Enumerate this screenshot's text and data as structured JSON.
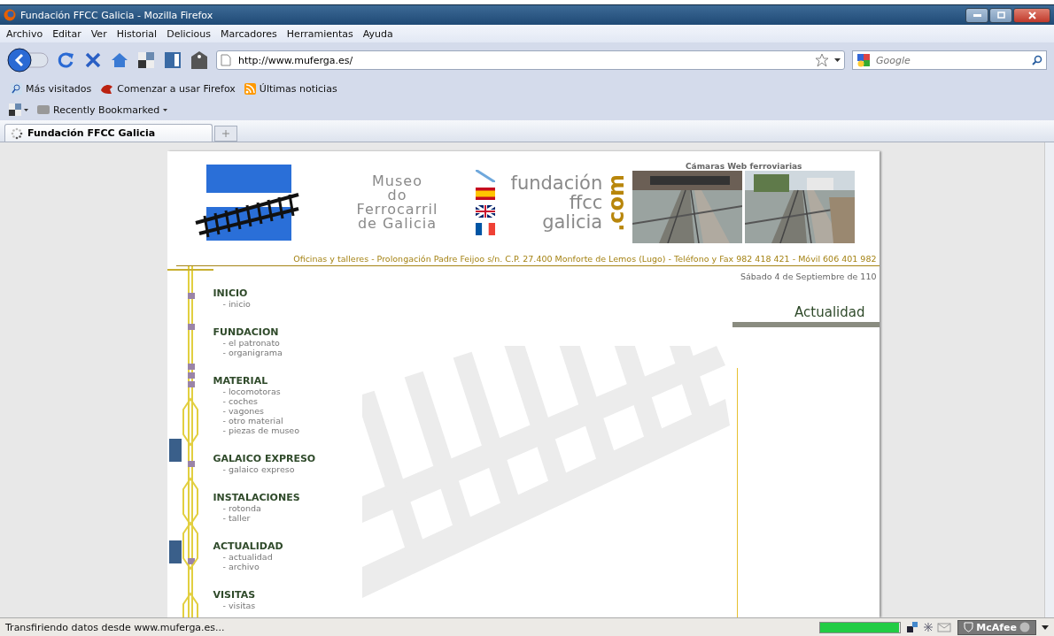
{
  "window": {
    "title": "Fundación FFCC Galicia - Mozilla Firefox"
  },
  "menu": [
    "Archivo",
    "Editar",
    "Ver",
    "Historial",
    "Delicious",
    "Marcadores",
    "Herramientas",
    "Ayuda"
  ],
  "address": {
    "value": "http://www.muferga.es/"
  },
  "search": {
    "placeholder": "Google"
  },
  "bookmarks": [
    {
      "label": "Más visitados",
      "kind": "search"
    },
    {
      "label": "Comenzar a usar Firefox",
      "kind": "firefox"
    },
    {
      "label": "Últimas noticias",
      "kind": "feed"
    }
  ],
  "bookmarks2": [
    {
      "label": "Recently Bookmarked"
    }
  ],
  "tabs": [
    {
      "label": "Fundación FFCC Galicia",
      "selected": true
    }
  ],
  "page": {
    "museum_name": [
      "Museo",
      "do",
      "Ferrocarril",
      "de Galicia"
    ],
    "brand": [
      "fundación",
      "ffcc",
      "galicia"
    ],
    "brand_suffix": ".com",
    "webcams_title": "Cámaras Web ferroviarias",
    "flags": [
      {
        "kind": "none"
      },
      {
        "kind": "es"
      },
      {
        "kind": "uk"
      },
      {
        "kind": "fr"
      }
    ],
    "address_line": "Oficinas y talleres - Prolongación Padre Feijoo s/n. C.P. 27.400 Monforte de Lemos (Lugo) - Teléfono y Fax 982 418 421 - Móvil 606 401 982",
    "date": "Sábado 4 de Septiembre de 110",
    "nav": [
      {
        "title": "INICIO",
        "items": [
          "- inicio"
        ]
      },
      {
        "title": "FUNDACION",
        "items": [
          "- el patronato",
          "- organigrama"
        ]
      },
      {
        "title": "MATERIAL",
        "items": [
          "- locomotoras",
          "- coches",
          "- vagones",
          "- otro material",
          "- piezas de museo"
        ]
      },
      {
        "title": "GALAICO EXPRESO",
        "items": [
          "- galaico expreso"
        ]
      },
      {
        "title": "INSTALACIONES",
        "items": [
          "- rotonda",
          "- taller"
        ]
      },
      {
        "title": "ACTUALIDAD",
        "items": [
          "- actualidad",
          "- archivo"
        ]
      },
      {
        "title": "VISITAS",
        "items": [
          "- visitas"
        ]
      }
    ],
    "news_heading": "Actualidad"
  },
  "status_bar": {
    "text": "Transfiriendo datos desde www.muferga.es...",
    "level": 0.98,
    "mcafee": "McAfee"
  }
}
